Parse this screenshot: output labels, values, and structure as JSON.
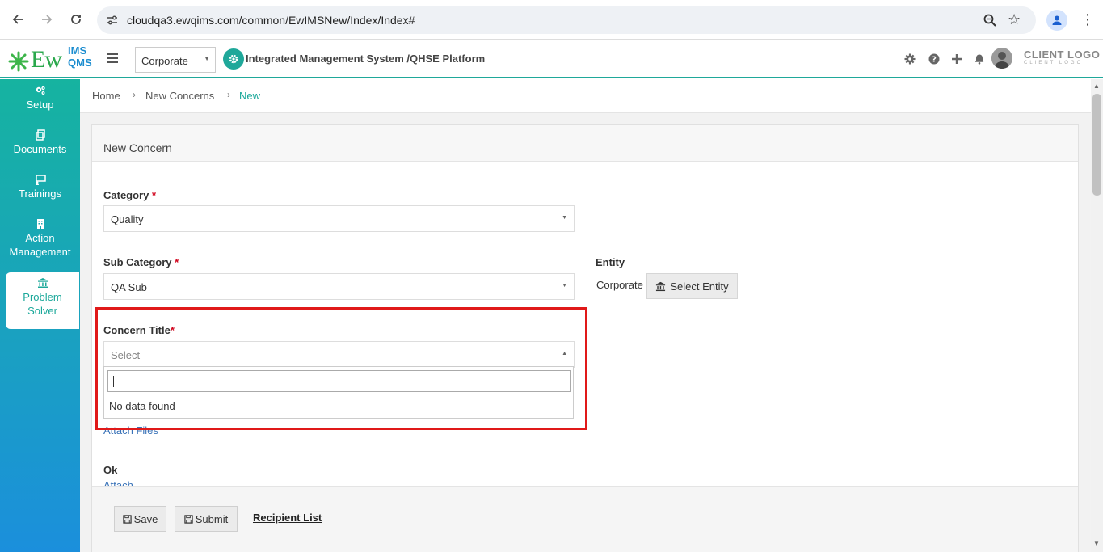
{
  "browser": {
    "url": "cloudqa3.ewqims.com/common/EwIMSNew/Index/Index#"
  },
  "header": {
    "logo_main": "Ew",
    "logo_sup": "IMS",
    "logo_sub": "QMS",
    "org_selected": "Corporate",
    "app_title": "Integrated Management System /QHSE Platform",
    "client_logo": "CLIENT LOGO",
    "client_logo_sub": "CLIENT LOGO"
  },
  "sidebar": {
    "items": [
      {
        "label": "Setup",
        "icon": "gears-icon"
      },
      {
        "label": "Documents",
        "icon": "copy-icon"
      },
      {
        "label": "Trainings",
        "icon": "presentation-icon"
      },
      {
        "label": "Action",
        "label2": "Management",
        "icon": "building-icon"
      },
      {
        "label": "Problem",
        "label2": "Solver",
        "icon": "bank-icon",
        "active": true
      }
    ]
  },
  "breadcrumb": {
    "home": "Home",
    "parent": "New Concerns",
    "current": "New"
  },
  "form": {
    "panel_title": "New Concern",
    "category_label": "Category",
    "category_value": "Quality",
    "subcategory_label": "Sub Category",
    "subcategory_value": "QA Sub",
    "entity_label": "Entity",
    "entity_value": "Corporate",
    "select_entity_label": "Select Entity",
    "concern_title_label": "Concern Title",
    "concern_title_placeholder": "Select",
    "dropdown_empty": "No data found",
    "attach_files": "Attach Files",
    "ok_label": "Ok",
    "attach_label": "Attach",
    "required_mark": "*"
  },
  "footer": {
    "save_label": "Save",
    "submit_label": "Submit",
    "recipient_label": "Recipient List"
  },
  "colors": {
    "accent": "#1fa89a",
    "highlight": "#e01919",
    "required": "#d0021b"
  }
}
